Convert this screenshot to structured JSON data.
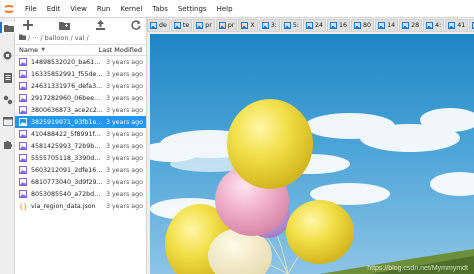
{
  "menubar": {
    "items": [
      "File",
      "Edit",
      "View",
      "Run",
      "Kernel",
      "Tabs",
      "Settings",
      "Help"
    ]
  },
  "filebrowser": {
    "breadcrumbs": {
      "root": "▇",
      "sep1": "/",
      "ellipsis": "···",
      "path": "/ balloon / val /"
    },
    "header": {
      "name": "Name",
      "modified": "Last Modified"
    },
    "files": [
      {
        "name": "14898532020_ba619...",
        "modified": "3 years ago"
      },
      {
        "name": "16335852991_f55de...",
        "modified": "3 years ago"
      },
      {
        "name": "24631331976_defa3...",
        "modified": "3 years ago"
      },
      {
        "name": "2917282960_06beee...",
        "modified": "3 years ago"
      },
      {
        "name": "3800636873_ace2c2...",
        "modified": "3 years ago"
      },
      {
        "name": "3825919971_93fb1e...",
        "modified": "3 years ago"
      },
      {
        "name": "410488422_5f8991f2...",
        "modified": "3 years ago"
      },
      {
        "name": "4581425993_72b9b1...",
        "modified": "3 years ago"
      },
      {
        "name": "5555705118_3390d7...",
        "modified": "3 years ago"
      },
      {
        "name": "5603212091_2dfe16...",
        "modified": "3 years ago"
      },
      {
        "name": "6810773040_3d9f29...",
        "modified": "3 years ago"
      },
      {
        "name": "8053085540_a72bd2...",
        "modified": "3 years ago"
      },
      {
        "name": "via_region_data.json",
        "modified": "3 years ago"
      }
    ],
    "selected_index": 5
  },
  "tabs": [
    "de",
    "te",
    "pr",
    "pr",
    "X",
    "3:",
    "5:",
    "24",
    "16",
    "80",
    "14",
    "28",
    "4:",
    "41",
    "56"
  ],
  "active_tab_index": 15,
  "active_tab_label": "3:",
  "watermark": "https://blog.csdn.net/Mymmymdt",
  "colors": {
    "accent": "#2196f3",
    "brand": "#f37726"
  }
}
